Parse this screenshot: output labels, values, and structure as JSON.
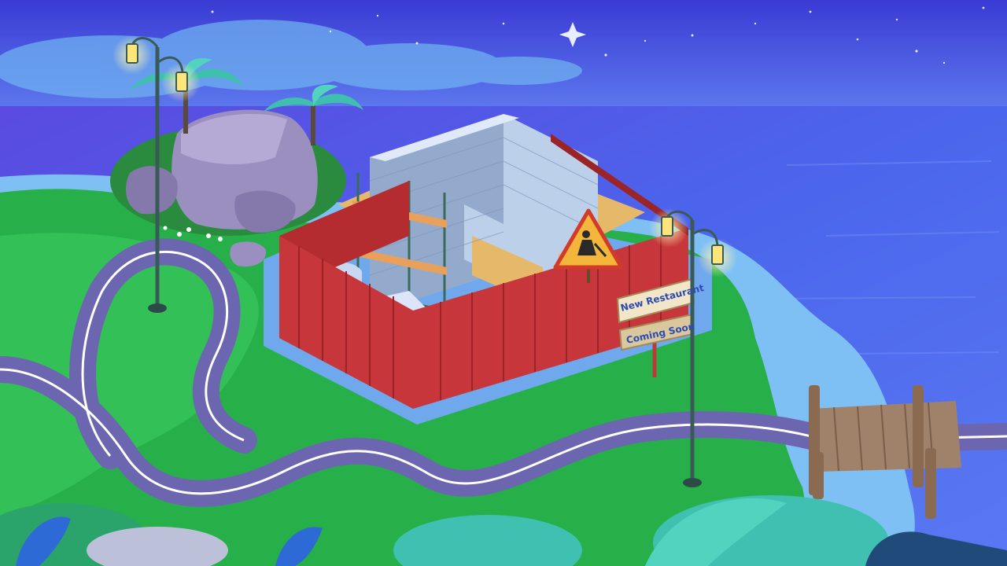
{
  "sign": {
    "top_text": "New Restaurant",
    "bottom_text": "Coming Soon"
  },
  "colors": {
    "sky_top": "#3c3fd8",
    "sky_mid": "#6a86f0",
    "sea": "#4a62ea",
    "sea_light": "#7aa3f6",
    "grass": "#27b04a",
    "grass_light": "#3ccf5e",
    "road": "#6c66b0",
    "road_line": "#ffffff",
    "fence": "#c7363a",
    "fence_dark": "#9b2428",
    "wall": "#bcd0ea",
    "wall_dark": "#94aacd",
    "floor": "#e6b86a",
    "dock": "#a0826a",
    "rock": "#8a80a8",
    "palm": "#3fc0b0",
    "sign_board": "#f2e6c8",
    "sign_text": "#2c4ab0"
  },
  "icons": {
    "warning_sign": "construction-worker-warning-icon",
    "sparkle": "sparkle-star-icon"
  }
}
